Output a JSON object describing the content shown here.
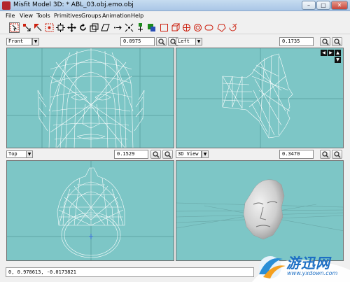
{
  "window": {
    "title": "Misfit Model 3D: * ABL_03.obj.emo.obj",
    "minimize": "–",
    "maximize": "□",
    "close": "✕"
  },
  "menu": [
    "File",
    "View",
    "Tools",
    "Primitives",
    "Groups",
    "Animation",
    "Help"
  ],
  "toolbar": {
    "tools": [
      "select-connected-mesh",
      "select-vertices",
      "select-faces",
      "select-bone-joints",
      "move",
      "rotate",
      "scale",
      "shear",
      "extrude",
      "attract-near",
      "attract-far",
      "create-vertex",
      "create-face",
      "create-rectangle",
      "create-cube",
      "create-ellipse",
      "create-cylinder",
      "create-torus",
      "create-polygon",
      "create-projection"
    ]
  },
  "panes": {
    "front": {
      "view": "Front",
      "zoom": "0.0975"
    },
    "left": {
      "view": "Left",
      "zoom": "0.1735"
    },
    "top": {
      "view": "Top",
      "zoom": "0.1529"
    },
    "perspective": {
      "view": "3D View",
      "zoom": "0.3470"
    }
  },
  "status": {
    "text": "0, 0.978613, -0.0173821"
  },
  "watermark": {
    "text": "游迅网",
    "url": "www.yxdown.com"
  },
  "colors": {
    "viewport_bg": "#7dc6c6",
    "wireframe": "#ffffff",
    "grid": "#5fa6a6"
  }
}
